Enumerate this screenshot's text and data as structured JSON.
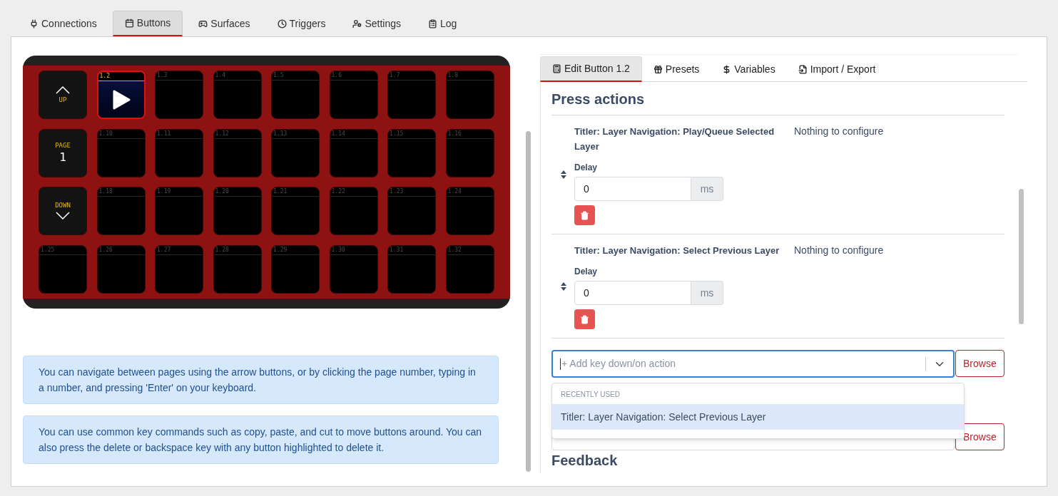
{
  "tabs": [
    {
      "label": "Connections",
      "selected": false
    },
    {
      "label": "Buttons",
      "selected": true
    },
    {
      "label": "Surfaces",
      "selected": false
    },
    {
      "label": "Triggers",
      "selected": false
    },
    {
      "label": "Settings",
      "selected": false
    },
    {
      "label": "Log",
      "selected": false
    }
  ],
  "keypad": {
    "rows": [
      [
        {
          "kind": "nav_up",
          "label": "UP"
        },
        {
          "kind": "button",
          "number": "1.2",
          "selected": true,
          "has_image": true
        },
        {
          "kind": "button",
          "number": "1.3",
          "selected": false,
          "has_image": false
        },
        {
          "kind": "button",
          "number": "1.4",
          "selected": false,
          "has_image": false
        },
        {
          "kind": "button",
          "number": "1.5",
          "selected": false,
          "has_image": false
        },
        {
          "kind": "button",
          "number": "1.6",
          "selected": false,
          "has_image": false
        },
        {
          "kind": "button",
          "number": "1.7",
          "selected": false,
          "has_image": false
        },
        {
          "kind": "button",
          "number": "1.8",
          "selected": false,
          "has_image": false
        }
      ],
      [
        {
          "kind": "nav_page",
          "label": "PAGE",
          "value": "1"
        },
        {
          "kind": "button",
          "number": "1.10",
          "selected": false,
          "has_image": false
        },
        {
          "kind": "button",
          "number": "1.11",
          "selected": false,
          "has_image": false
        },
        {
          "kind": "button",
          "number": "1.12",
          "selected": false,
          "has_image": false
        },
        {
          "kind": "button",
          "number": "1.13",
          "selected": false,
          "has_image": false
        },
        {
          "kind": "button",
          "number": "1.14",
          "selected": false,
          "has_image": false
        },
        {
          "kind": "button",
          "number": "1.15",
          "selected": false,
          "has_image": false
        },
        {
          "kind": "button",
          "number": "1.16",
          "selected": false,
          "has_image": false
        }
      ],
      [
        {
          "kind": "nav_down",
          "label": "DOWN"
        },
        {
          "kind": "button",
          "number": "1.18",
          "selected": false,
          "has_image": false
        },
        {
          "kind": "button",
          "number": "1.19",
          "selected": false,
          "has_image": false
        },
        {
          "kind": "button",
          "number": "1.20",
          "selected": false,
          "has_image": false
        },
        {
          "kind": "button",
          "number": "1.21",
          "selected": false,
          "has_image": false
        },
        {
          "kind": "button",
          "number": "1.22",
          "selected": false,
          "has_image": false
        },
        {
          "kind": "button",
          "number": "1.23",
          "selected": false,
          "has_image": false
        },
        {
          "kind": "button",
          "number": "1.24",
          "selected": false,
          "has_image": false
        }
      ],
      [
        {
          "kind": "button",
          "number": "1.25",
          "selected": false,
          "has_image": false
        },
        {
          "kind": "button",
          "number": "1.26",
          "selected": false,
          "has_image": false
        },
        {
          "kind": "button",
          "number": "1.27",
          "selected": false,
          "has_image": false
        },
        {
          "kind": "button",
          "number": "1.28",
          "selected": false,
          "has_image": false
        },
        {
          "kind": "button",
          "number": "1.29",
          "selected": false,
          "has_image": false
        },
        {
          "kind": "button",
          "number": "1.30",
          "selected": false,
          "has_image": false
        },
        {
          "kind": "button",
          "number": "1.31",
          "selected": false,
          "has_image": false
        },
        {
          "kind": "button",
          "number": "1.32",
          "selected": false,
          "has_image": false
        }
      ]
    ]
  },
  "notes": [
    "You can navigate between pages using the arrow buttons, or by clicking the page number, typing in a number, and pressing 'Enter' on your keyboard.",
    "You can use common key commands such as copy, paste, and cut to move buttons around. You can also press the delete or backspace key with any button highlighted to delete it."
  ],
  "editor_tabs": [
    {
      "label": "Edit Button 1.2",
      "selected": true
    },
    {
      "label": "Presets",
      "selected": false
    },
    {
      "label": "Variables",
      "selected": false
    },
    {
      "label": "Import / Export",
      "selected": false
    }
  ],
  "press_actions": {
    "title": "Press actions",
    "actions": [
      {
        "name": "Titler: Layer Navigation: Play/Queue Selected Layer",
        "options": "Nothing to configure",
        "delay_label": "Delay",
        "delay_value": "0",
        "unit": "ms"
      },
      {
        "name": "Titler: Layer Navigation: Select Previous Layer",
        "options": "Nothing to configure",
        "delay_label": "Delay",
        "delay_value": "0",
        "unit": "ms"
      }
    ],
    "add_down": {
      "placeholder": "+ Add key down/on action",
      "focused": true,
      "browse": "Browse"
    },
    "dropdown": {
      "group": "RECENTLY USED",
      "options": [
        {
          "label": "Titler: Layer Navigation: Select Previous Layer",
          "selected": true
        }
      ]
    },
    "add_up": {
      "focused": false,
      "browse": "Browse"
    }
  },
  "feedback": {
    "title": "Feedback"
  }
}
